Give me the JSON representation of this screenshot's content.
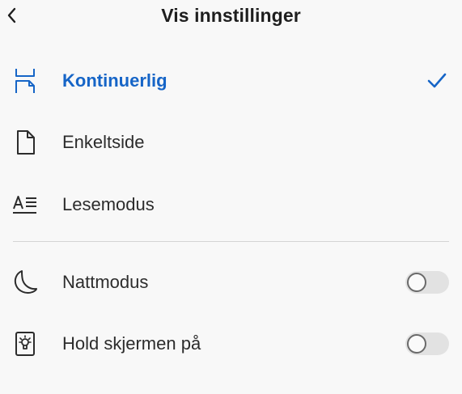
{
  "header": {
    "title": "Vis innstillinger",
    "back_icon": "chevron-left-icon"
  },
  "view_modes": [
    {
      "label": "Kontinuerlig",
      "icon": "continuous-scroll-icon",
      "selected": true
    },
    {
      "label": "Enkeltside",
      "icon": "single-page-icon",
      "selected": false
    },
    {
      "label": "Lesemodus",
      "icon": "reading-mode-icon",
      "selected": false
    }
  ],
  "toggles": [
    {
      "label": "Nattmodus",
      "icon": "moon-icon",
      "on": false
    },
    {
      "label": "Hold skjermen på",
      "icon": "screen-on-icon",
      "on": false
    }
  ],
  "colors": {
    "accent": "#1665c7",
    "background": "#f8f8f8",
    "text": "#2c2c2c",
    "divider": "#d4d4d4",
    "toggle_off_track": "#e2e2e2"
  }
}
